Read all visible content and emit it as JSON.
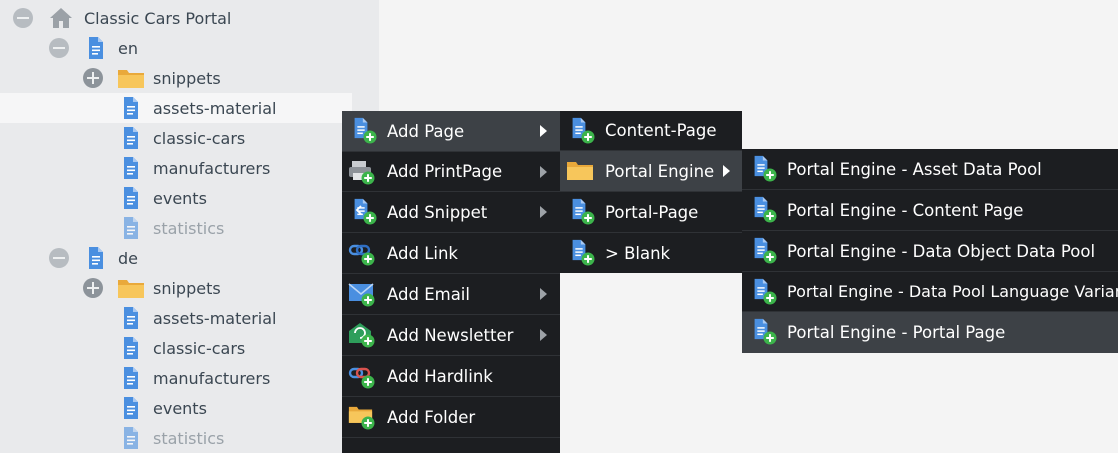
{
  "tree": {
    "root": {
      "label": "Classic Cars Portal",
      "icon": "home-icon"
    },
    "items": [
      {
        "label": "en",
        "icon": "document-icon"
      },
      {
        "label": "snippets",
        "icon": "folder-icon"
      },
      {
        "label": "assets-material",
        "icon": "document-icon"
      },
      {
        "label": "classic-cars",
        "icon": "document-icon"
      },
      {
        "label": "manufacturers",
        "icon": "document-icon"
      },
      {
        "label": "events",
        "icon": "document-icon"
      },
      {
        "label": "statistics",
        "icon": "document-icon"
      },
      {
        "label": "de",
        "icon": "document-icon"
      },
      {
        "label": "snippets",
        "icon": "folder-icon"
      },
      {
        "label": "assets-material",
        "icon": "document-icon"
      },
      {
        "label": "classic-cars",
        "icon": "document-icon"
      },
      {
        "label": "manufacturers",
        "icon": "document-icon"
      },
      {
        "label": "events",
        "icon": "document-icon"
      },
      {
        "label": "statistics",
        "icon": "document-icon"
      }
    ]
  },
  "context_menu": {
    "items": [
      {
        "label": "Add Page",
        "icon": "add-page-icon"
      },
      {
        "label": "Add PrintPage",
        "icon": "add-printpage-icon"
      },
      {
        "label": "Add Snippet",
        "icon": "add-snippet-icon"
      },
      {
        "label": "Add Link",
        "icon": "add-link-icon"
      },
      {
        "label": "Add Email",
        "icon": "add-email-icon"
      },
      {
        "label": "Add Newsletter",
        "icon": "add-newsletter-icon"
      },
      {
        "label": "Add Hardlink",
        "icon": "add-hardlink-icon"
      },
      {
        "label": "Add Folder",
        "icon": "add-folder-icon"
      }
    ]
  },
  "page_submenu": {
    "items": [
      {
        "label": "Content-Page",
        "icon": "add-page-icon"
      },
      {
        "label": "Portal Engine",
        "icon": "folder-icon"
      },
      {
        "label": "Portal-Page",
        "icon": "add-page-icon"
      },
      {
        "label": "> Blank",
        "icon": "add-page-icon"
      }
    ]
  },
  "portal_engine_submenu": {
    "items": [
      {
        "label": "Portal Engine - Asset Data Pool",
        "icon": "add-page-icon"
      },
      {
        "label": "Portal Engine - Content Page",
        "icon": "add-page-icon"
      },
      {
        "label": "Portal Engine - Data Object Data Pool",
        "icon": "add-page-icon"
      },
      {
        "label": "Portal Engine - Data Pool Language Variant",
        "icon": "add-page-icon"
      },
      {
        "label": "Portal Engine - Portal Page",
        "icon": "add-page-icon"
      }
    ]
  },
  "colors": {
    "menu_bg": "#1c1e21",
    "menu_active": "#3d4146",
    "tree_bg": "#e9eaec",
    "doc_blue": "#4a8fe0",
    "plus_green": "#3cb44b",
    "folder_yellow": "#f7c65b"
  }
}
